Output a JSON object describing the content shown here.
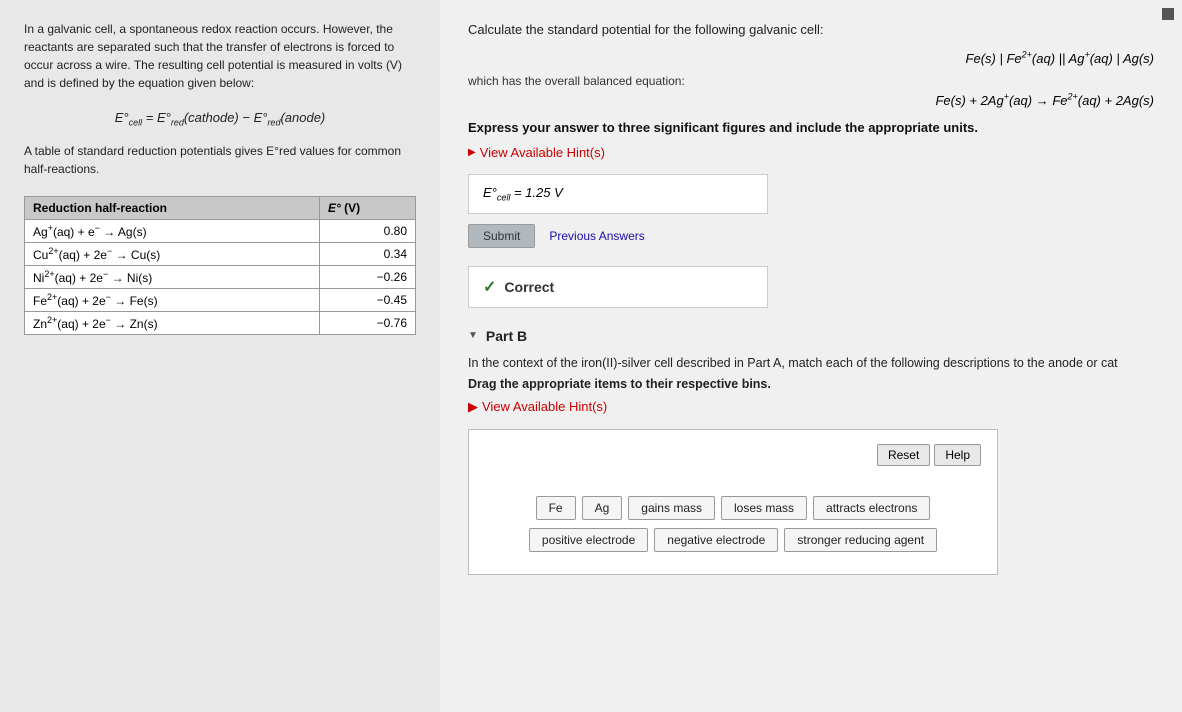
{
  "left": {
    "intro": "In a galvanic cell, a spontaneous redox reaction occurs. However, the reactants are separated such that the transfer of electrons is forced to occur across a wire. The resulting cell potential is measured in volts (V) and is defined by the equation given below:",
    "cell_equation": "E°cell = E°red(cathode) − E°red(anode)",
    "table_note": "A table of standard reduction potentials gives E°red values for common half-reactions.",
    "table": {
      "headers": [
        "Reduction half-reaction",
        "E° (V)"
      ],
      "rows": [
        [
          "Ag⁺(aq) + e⁻ → Ag(s)",
          "0.80"
        ],
        [
          "Cu²⁺(aq) + 2e⁻ → Cu(s)",
          "0.34"
        ],
        [
          "Ni²⁺(aq) + 2e⁻ → Ni(s)",
          "−0.26"
        ],
        [
          "Fe²⁺(aq) + 2e⁻ → Fe(s)",
          "−0.45"
        ],
        [
          "Zn²⁺(aq) + 2e⁻ → Zn(s)",
          "−0.76"
        ]
      ]
    }
  },
  "right": {
    "question": "Calculate the standard potential for the following galvanic cell:",
    "cell_notation": "Fe(s) | Fe²⁺(aq) || Ag⁺(aq) | Ag(s)",
    "balanced_label": "which has the overall balanced equation:",
    "balanced_equation": "Fe(s) + 2Ag⁺(aq) → Fe²⁺(aq) + 2Ag(s)",
    "sig_figs_note": "Express your answer to three significant figures and include the appropriate units.",
    "hint_label": "View Available Hint(s)",
    "answer_value": "E°cell = 1.25 V",
    "submit_label": "Submit",
    "prev_answers_label": "Previous Answers",
    "correct_label": "Correct",
    "part_b": {
      "header": "Part B",
      "description": "In the context of the iron(II)-silver cell described in Part A, match each of the following descriptions to the anode or cat",
      "drag_instruction": "Drag the appropriate items to their respective bins.",
      "hint_label": "View Available Hint(s)",
      "reset_label": "Reset",
      "help_label": "Help",
      "items": [
        "Fe",
        "Ag",
        "gains mass",
        "loses mass",
        "attracts electrons",
        "positive electrode",
        "negative electrode",
        "stronger reducing agent"
      ]
    }
  }
}
